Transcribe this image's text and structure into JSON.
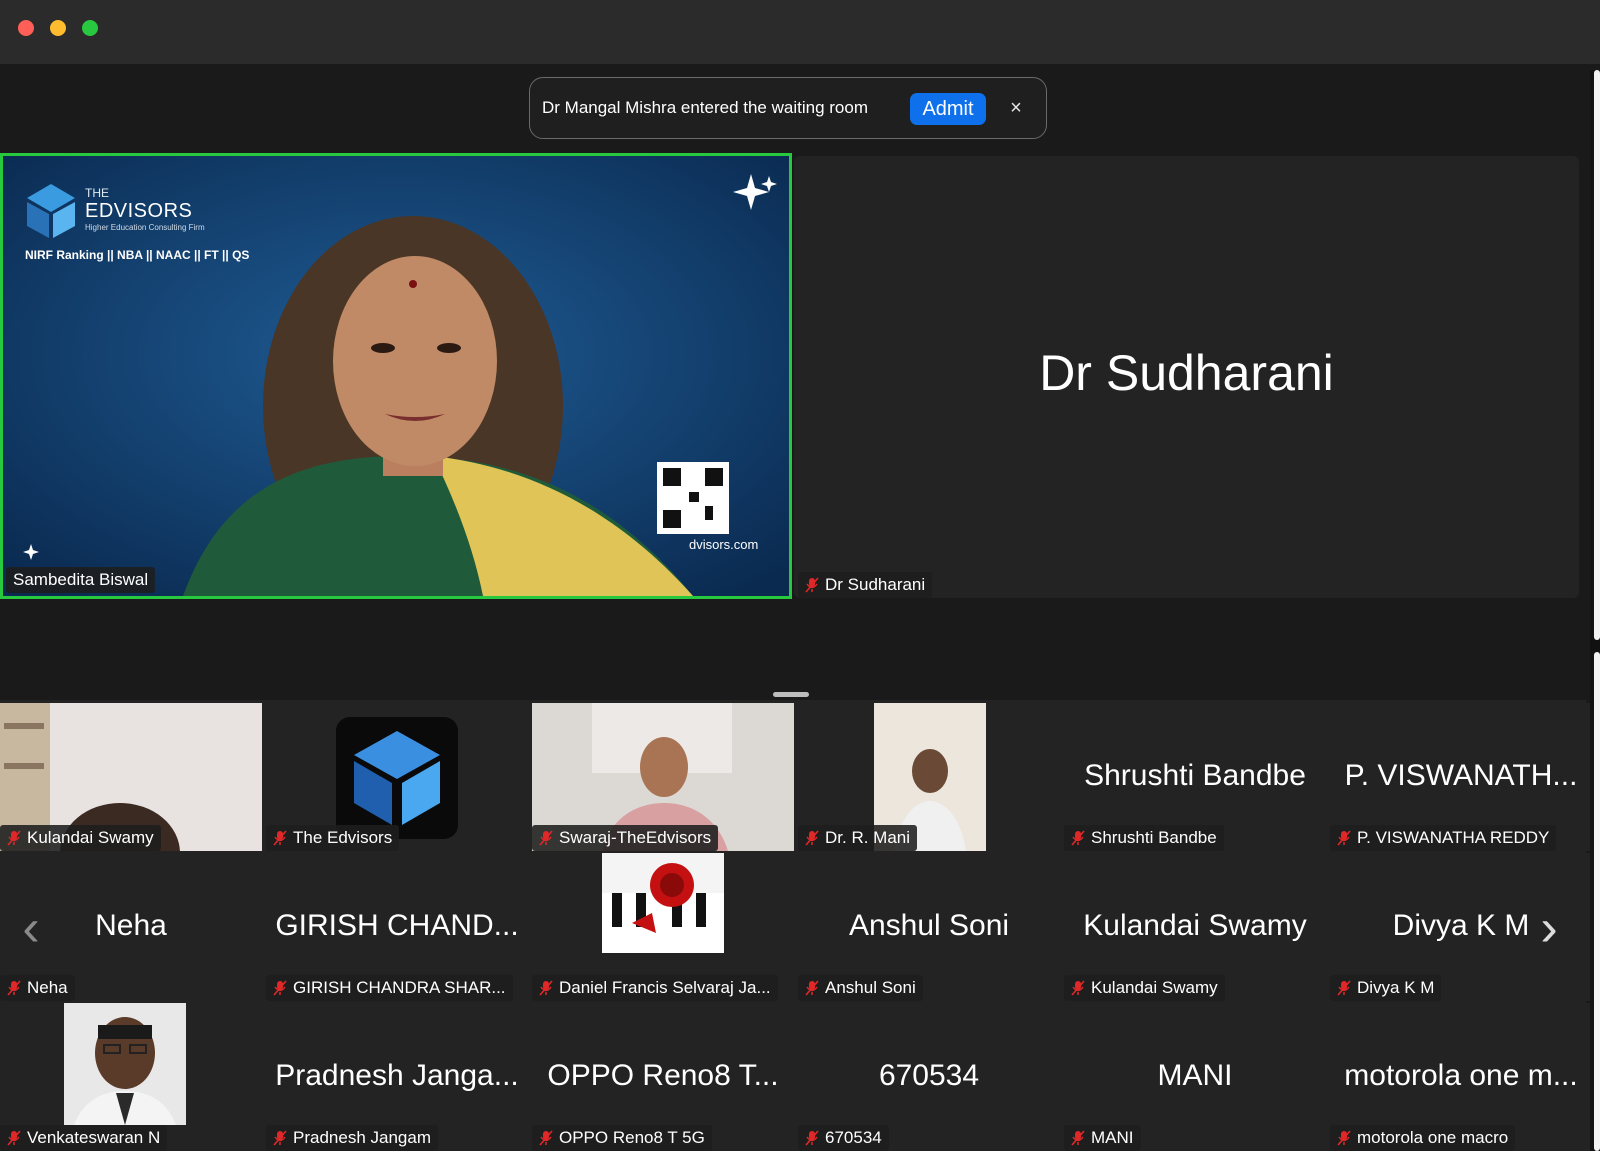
{
  "notification": {
    "text": "Dr Mangal Mishra entered the waiting room",
    "admit_label": "Admit",
    "close_label": "×"
  },
  "main_tile": {
    "name": "Sambedita Biswal",
    "brand_the": "THE",
    "brand_name": "EDVISORS",
    "brand_tagline": "Higher Education Consulting Firm",
    "brand_services": "NIRF Ranking || NBA || NAAC || FT || QS",
    "brand_url": "dvisors.com"
  },
  "second_tile": {
    "display_name": "Dr Sudharani",
    "name": "Dr Sudharani"
  },
  "gallery": [
    {
      "center": "",
      "name": "Kulandai Swamy"
    },
    {
      "center": "",
      "name": "The Edvisors"
    },
    {
      "center": "",
      "name": "Swaraj-TheEdvisors"
    },
    {
      "center": "",
      "name": "Dr. R. Mani"
    },
    {
      "center": "Shrushti Bandbe",
      "name": "Shrushti Bandbe"
    },
    {
      "center": "P. VISWANATH...",
      "name": "P. VISWANATHA REDDY"
    },
    {
      "center": "Neha",
      "name": "Neha"
    },
    {
      "center": "GIRISH CHAND...",
      "name": "GIRISH CHANDRA SHAR..."
    },
    {
      "center": "",
      "name": "Daniel Francis Selvaraj Ja..."
    },
    {
      "center": "Anshul Soni",
      "name": "Anshul Soni"
    },
    {
      "center": "Kulandai Swamy",
      "name": "Kulandai Swamy"
    },
    {
      "center": "Divya K M",
      "name": "Divya K M"
    },
    {
      "center": "",
      "name": "Venkateswaran N"
    },
    {
      "center": "Pradnesh Janga...",
      "name": "Pradnesh Jangam"
    },
    {
      "center": "OPPO Reno8 T...",
      "name": "OPPO Reno8 T 5G"
    },
    {
      "center": "670534",
      "name": "670534"
    },
    {
      "center": "MANI",
      "name": "MANI"
    },
    {
      "center": "motorola one m...",
      "name": "motorola one macro"
    }
  ],
  "colors": {
    "active_speaker_border": "#27c93f",
    "admit_button": "#0e71eb",
    "muted_mic": "#e02828"
  },
  "icons": {
    "muted": "microphone-muted-icon",
    "prev": "chevron-left-icon",
    "next": "chevron-right-icon"
  },
  "nav": {
    "prev": "‹",
    "next": "›"
  }
}
